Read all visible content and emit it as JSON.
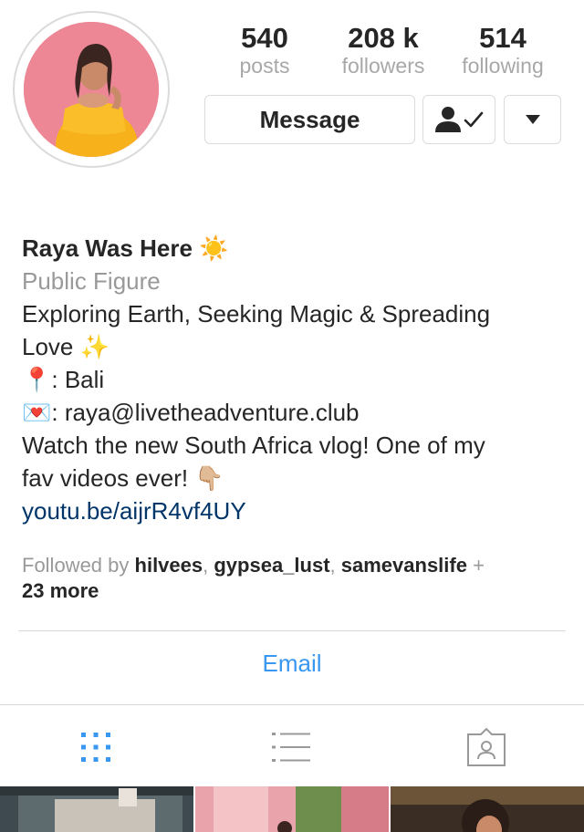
{
  "profile": {
    "stats": {
      "posts": {
        "value": "540",
        "label": "posts"
      },
      "followers": {
        "value": "208 k",
        "label": "followers"
      },
      "following": {
        "value": "514",
        "label": "following"
      }
    },
    "buttons": {
      "message": "Message"
    },
    "name": "Raya Was Here",
    "name_emoji": "☀️",
    "category": "Public Figure",
    "bio": {
      "line1": "Exploring Earth, Seeking Magic & Spreading",
      "line2": "Love",
      "line2_emoji": "✨",
      "location_emoji": "📍",
      "location": ": Bali",
      "mail_emoji": "💌",
      "email": ": raya@livetheadventure.club",
      "line5": "Watch the new South Africa vlog! One of my",
      "line6": "fav videos ever!",
      "line6_emoji": "👇🏼",
      "link": "youtu.be/aijrR4vf4UY"
    },
    "followed_by": {
      "prefix": "Followed by",
      "users": [
        "hilvees",
        "gypsea_lust",
        "samevanslife"
      ],
      "suffix": "+",
      "more": "23 more"
    },
    "email_button": "Email"
  },
  "tabs": [
    {
      "icon": "grid-icon",
      "active": true
    },
    {
      "icon": "list-icon",
      "active": false
    },
    {
      "icon": "tagged-icon",
      "active": false
    }
  ],
  "colors": {
    "accent": "#3897f0",
    "link": "#003569",
    "muted": "#999999",
    "border": "#dbdbdb"
  }
}
